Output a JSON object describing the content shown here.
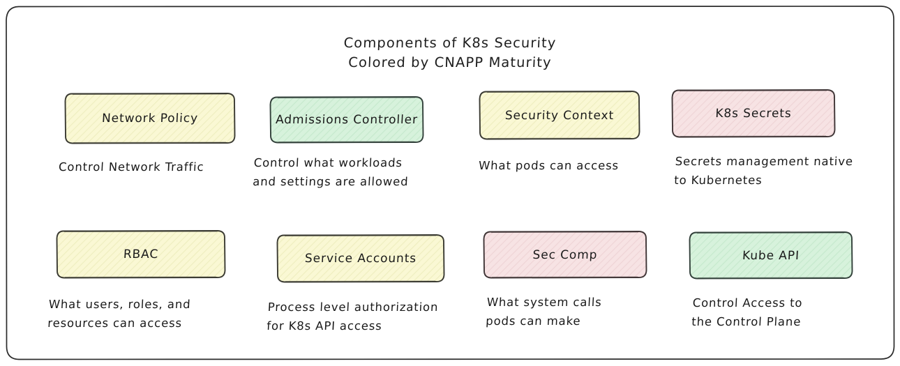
{
  "diagram": {
    "title_line_1": "Components of K8s Security",
    "title_line_2": "Colored by CNAPP Maturity",
    "frame_border_color": "#2b2b2b",
    "background_color": "#ffffff",
    "text_color": "#1a1a1a"
  },
  "palette": {
    "yellow_fill": "#faf8d4",
    "yellow_stroke": "#3a3a32",
    "green_fill": "#d7f2dc",
    "green_stroke": "#32403a",
    "pink_fill": "#f7e3e4",
    "pink_stroke": "#3f3536"
  },
  "nodes": [
    {
      "id": "network-policy",
      "label": "Network Policy",
      "caption": "Control Network Traffic",
      "maturity_color": "yellow",
      "row": 1,
      "column": 1
    },
    {
      "id": "admissions-controller",
      "label": "Admissions Controller",
      "caption": "Control what workloads\nand settings are allowed",
      "maturity_color": "green",
      "row": 1,
      "column": 2
    },
    {
      "id": "security-context",
      "label": "Security Context",
      "caption": "What pods can access",
      "maturity_color": "yellow",
      "row": 1,
      "column": 3
    },
    {
      "id": "k8s-secrets",
      "label": "K8s Secrets",
      "caption": "Secrets management native\nto Kubernetes",
      "maturity_color": "pink",
      "row": 1,
      "column": 4
    },
    {
      "id": "rbac",
      "label": "RBAC",
      "caption": "What users, roles, and\nresources can access",
      "maturity_color": "yellow",
      "row": 2,
      "column": 1
    },
    {
      "id": "service-accounts",
      "label": "Service Accounts",
      "caption": "Process level authorization\nfor K8s API access",
      "maturity_color": "yellow",
      "row": 2,
      "column": 2
    },
    {
      "id": "sec-comp",
      "label": "Sec Comp",
      "caption": "What system calls\npods can make",
      "maturity_color": "pink",
      "row": 2,
      "column": 3
    },
    {
      "id": "kube-api",
      "label": "Kube API",
      "caption": "Control Access to\nthe Control Plane",
      "maturity_color": "green",
      "row": 2,
      "column": 4
    }
  ]
}
